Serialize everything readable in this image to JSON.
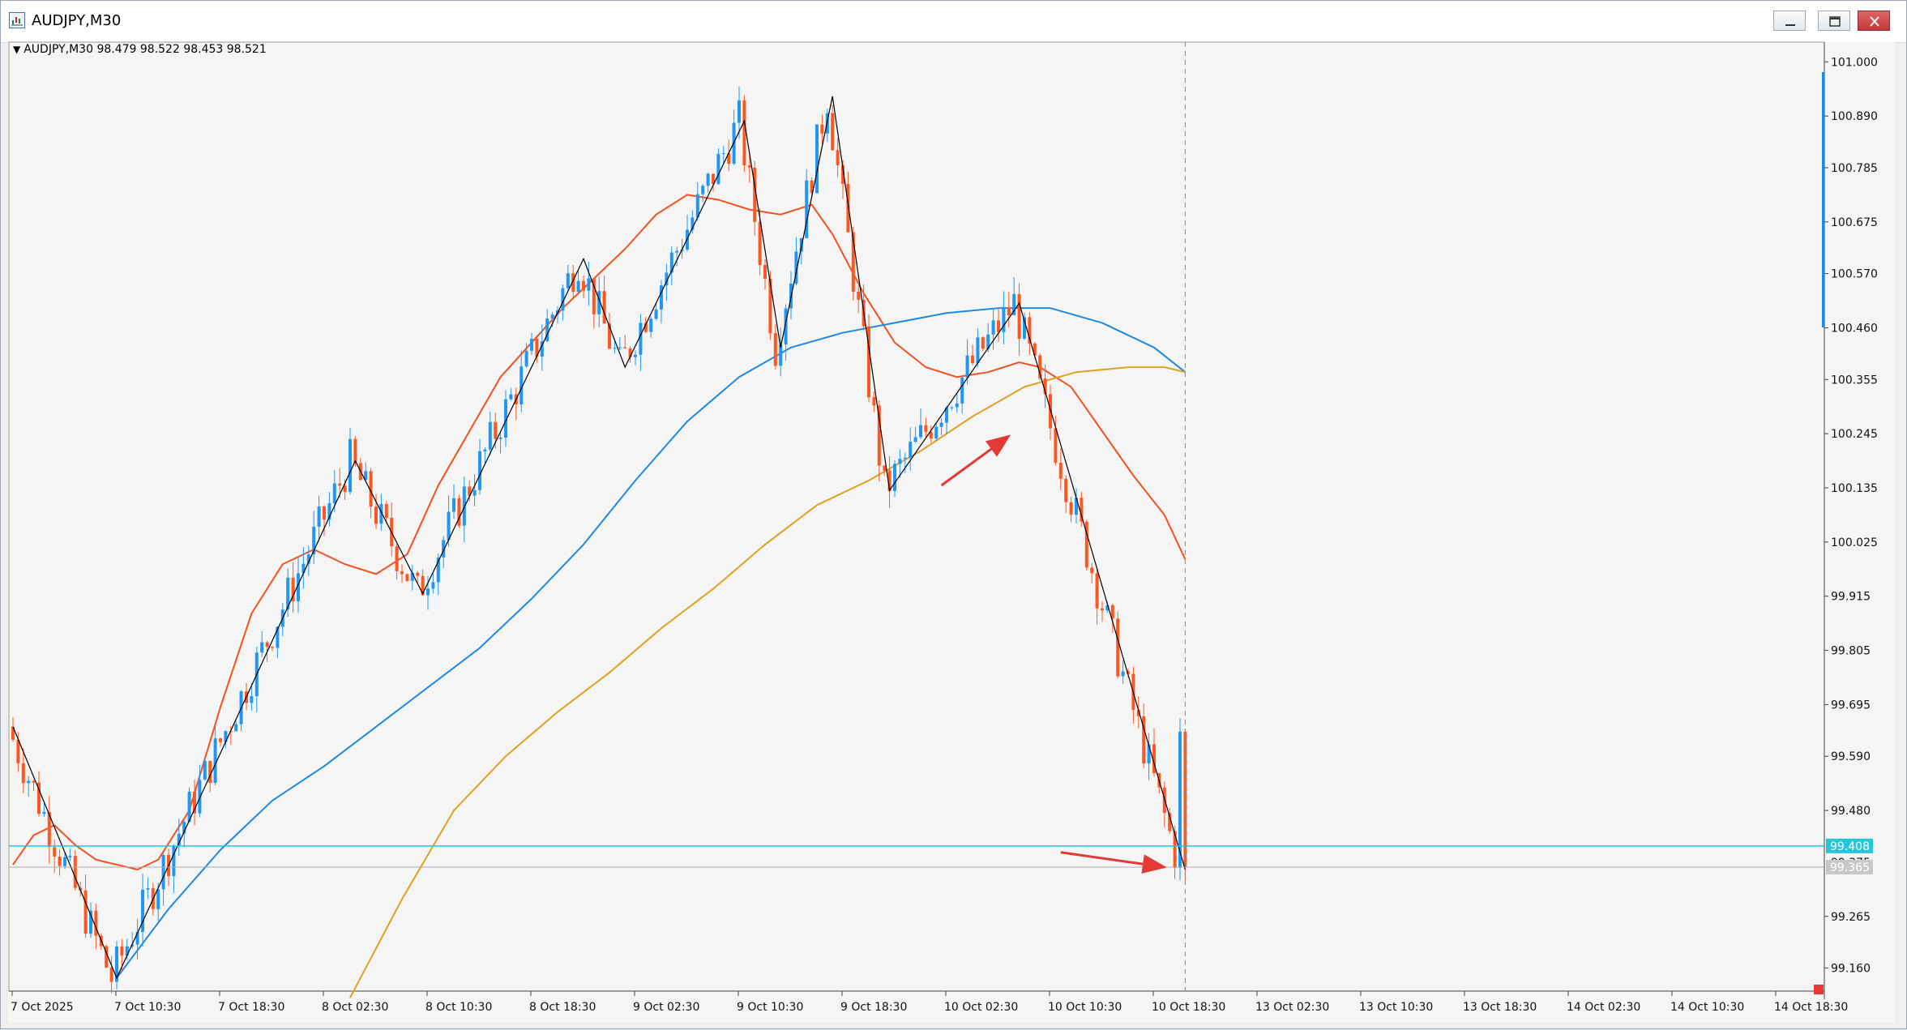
{
  "window": {
    "title": "AUDJPY,M30"
  },
  "chart_info": {
    "header": "AUDJPY,M30  98.479 98.522 98.453 98.521"
  },
  "colors": {
    "bull": "#2196f3",
    "bear": "#ff5722",
    "ma_fast": "#f4511e",
    "ma_mid": "#1e88e5",
    "ma_slow": "#e0a020",
    "zigzag": "#000000",
    "hline": "#26c6da",
    "bid_line": "#b0b0b0",
    "arrow": "#e53935"
  },
  "chart_data": {
    "type": "candlestick",
    "symbol": "AUDJPY",
    "timeframe": "M30",
    "ylim": [
      99.105,
      101.04
    ],
    "price_ticks": [
      "101.000",
      "100.890",
      "100.785",
      "100.675",
      "100.570",
      "100.460",
      "100.355",
      "100.245",
      "100.135",
      "100.025",
      "99.915",
      "99.805",
      "99.695",
      "99.590",
      "99.480",
      "99.265",
      "99.160"
    ],
    "time_ticks": [
      "7 Oct 2025",
      "7 Oct 10:30",
      "7 Oct 18:30",
      "8 Oct 02:30",
      "8 Oct 10:30",
      "8 Oct 18:30",
      "9 Oct 02:30",
      "9 Oct 10:30",
      "9 Oct 18:30",
      "10 Oct 02:30",
      "10 Oct 10:30",
      "10 Oct 18:30",
      "13 Oct 02:30",
      "13 Oct 10:30",
      "13 Oct 18:30",
      "14 Oct 02:30",
      "14 Oct 10:30",
      "14 Oct 18:30"
    ],
    "horizontal_line": {
      "price": 99.408,
      "label": "99.408"
    },
    "bid_line": {
      "price": 99.365,
      "label": "99.365"
    },
    "hidden_tick_label": "99.375",
    "candles": [],
    "ma_series": [
      {
        "key": "ma_fast",
        "points": [
          [
            0,
            99.37
          ],
          [
            4,
            99.43
          ],
          [
            8,
            99.45
          ],
          [
            12,
            99.41
          ],
          [
            16,
            99.38
          ],
          [
            20,
            99.37
          ],
          [
            24,
            99.36
          ],
          [
            28,
            99.38
          ],
          [
            34,
            99.48
          ],
          [
            40,
            99.69
          ],
          [
            46,
            99.88
          ],
          [
            52,
            99.98
          ],
          [
            58,
            100.01
          ],
          [
            64,
            99.98
          ],
          [
            70,
            99.96
          ],
          [
            76,
            100.0
          ],
          [
            82,
            100.14
          ],
          [
            88,
            100.25
          ],
          [
            94,
            100.36
          ],
          [
            100,
            100.43
          ],
          [
            106,
            100.5
          ],
          [
            112,
            100.56
          ],
          [
            118,
            100.62
          ],
          [
            124,
            100.69
          ],
          [
            130,
            100.73
          ],
          [
            136,
            100.72
          ],
          [
            142,
            100.7
          ],
          [
            148,
            100.69
          ],
          [
            154,
            100.71
          ],
          [
            158,
            100.65
          ],
          [
            164,
            100.53
          ],
          [
            170,
            100.43
          ],
          [
            176,
            100.38
          ],
          [
            182,
            100.36
          ],
          [
            188,
            100.37
          ],
          [
            194,
            100.39
          ],
          [
            198,
            100.38
          ],
          [
            204,
            100.34
          ],
          [
            210,
            100.25
          ],
          [
            216,
            100.16
          ],
          [
            222,
            100.08
          ],
          [
            226,
            99.99
          ]
        ]
      },
      {
        "key": "ma_mid",
        "points": [
          [
            20,
            99.14
          ],
          [
            30,
            99.28
          ],
          [
            40,
            99.4
          ],
          [
            50,
            99.5
          ],
          [
            60,
            99.57
          ],
          [
            70,
            99.65
          ],
          [
            80,
            99.73
          ],
          [
            90,
            99.81
          ],
          [
            100,
            99.91
          ],
          [
            110,
            100.02
          ],
          [
            120,
            100.15
          ],
          [
            130,
            100.27
          ],
          [
            140,
            100.36
          ],
          [
            150,
            100.42
          ],
          [
            160,
            100.45
          ],
          [
            170,
            100.47
          ],
          [
            180,
            100.49
          ],
          [
            190,
            100.5
          ],
          [
            200,
            100.5
          ],
          [
            210,
            100.47
          ],
          [
            220,
            100.42
          ],
          [
            226,
            100.37
          ]
        ]
      },
      {
        "key": "ma_slow",
        "points": [
          [
            65,
            99.1
          ],
          [
            75,
            99.3
          ],
          [
            85,
            99.48
          ],
          [
            95,
            99.59
          ],
          [
            105,
            99.68
          ],
          [
            115,
            99.76
          ],
          [
            125,
            99.85
          ],
          [
            135,
            99.93
          ],
          [
            145,
            100.02
          ],
          [
            155,
            100.1
          ],
          [
            165,
            100.15
          ],
          [
            175,
            100.21
          ],
          [
            185,
            100.28
          ],
          [
            195,
            100.34
          ],
          [
            205,
            100.37
          ],
          [
            215,
            100.38
          ],
          [
            222,
            100.38
          ],
          [
            226,
            100.37
          ]
        ]
      }
    ],
    "zigzag": [
      [
        0,
        99.65
      ],
      [
        20,
        99.14
      ],
      [
        66,
        100.19
      ],
      [
        79,
        99.92
      ],
      [
        110,
        100.6
      ],
      [
        118,
        100.38
      ],
      [
        141,
        100.88
      ],
      [
        148,
        100.42
      ],
      [
        158,
        100.93
      ],
      [
        169,
        100.13
      ],
      [
        194,
        100.51
      ],
      [
        226,
        99.36
      ]
    ],
    "arrows": [
      {
        "from": [
          179,
          100.14
        ],
        "to": [
          192,
          100.24
        ]
      },
      {
        "from": [
          202,
          99.395
        ],
        "to": [
          222,
          99.365
        ]
      }
    ],
    "vline_index": 226,
    "visible_bars": 360
  }
}
